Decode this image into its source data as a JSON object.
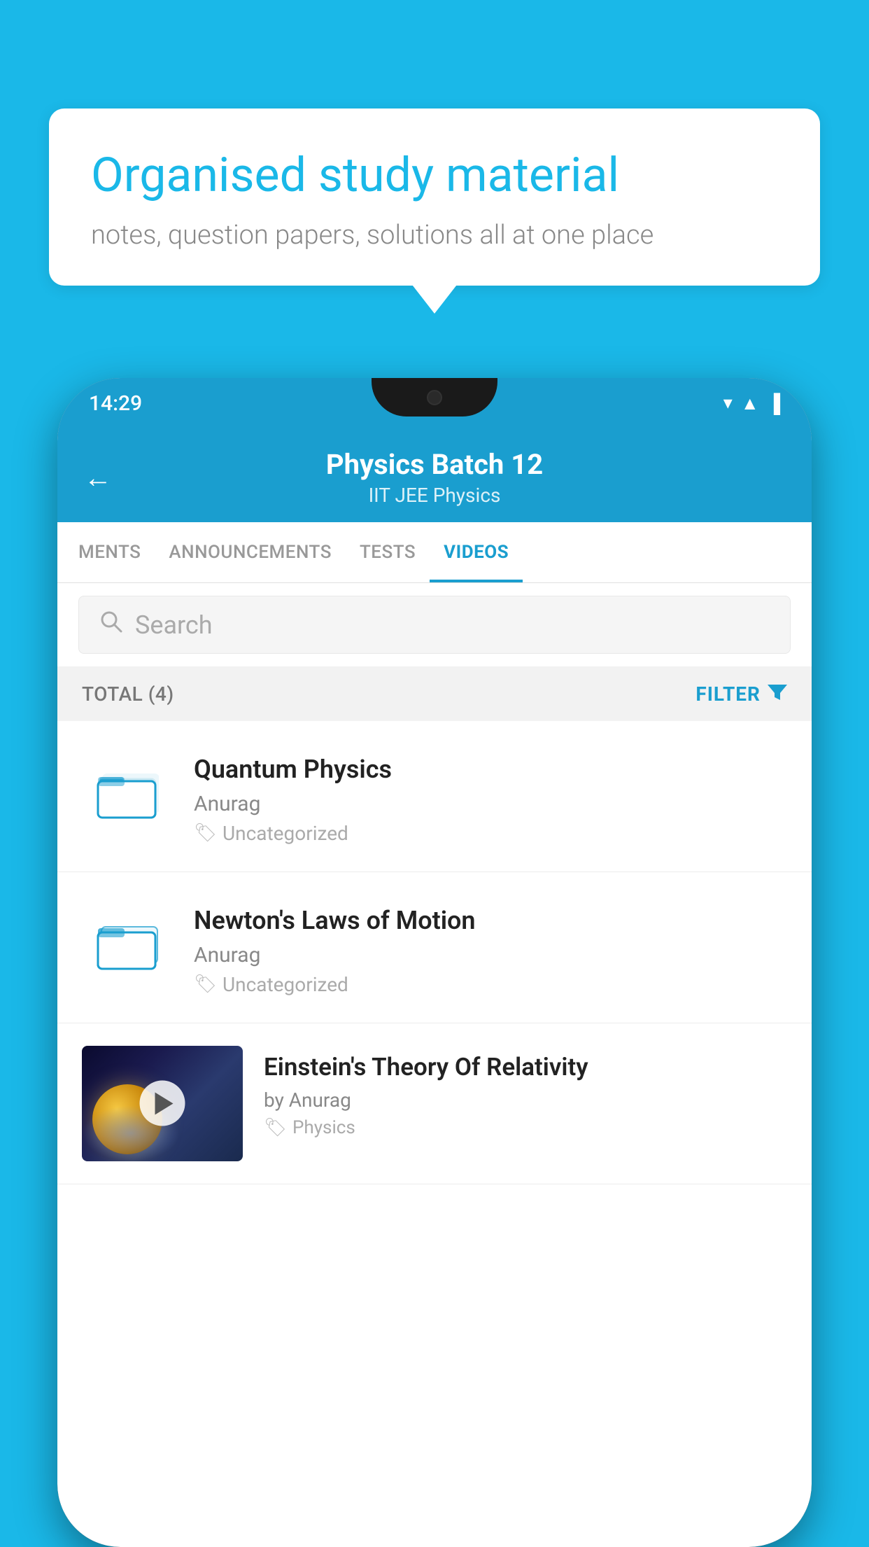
{
  "background": {
    "color": "#1ab8e8"
  },
  "speech_bubble": {
    "heading": "Organised study material",
    "subtext": "notes, question papers, solutions all at one place"
  },
  "phone": {
    "status_bar": {
      "time": "14:29",
      "icons": [
        "wifi",
        "signal",
        "battery"
      ]
    },
    "header": {
      "back_label": "←",
      "title": "Physics Batch 12",
      "subtitle": "IIT JEE   Physics"
    },
    "tabs": [
      {
        "label": "MENTS",
        "active": false
      },
      {
        "label": "ANNOUNCEMENTS",
        "active": false
      },
      {
        "label": "TESTS",
        "active": false
      },
      {
        "label": "VIDEOS",
        "active": true
      }
    ],
    "search": {
      "placeholder": "Search"
    },
    "filter_row": {
      "total_label": "TOTAL (4)",
      "filter_label": "FILTER"
    },
    "video_list": [
      {
        "id": "quantum",
        "title": "Quantum Physics",
        "author": "Anurag",
        "tag": "Uncategorized",
        "has_thumbnail": false
      },
      {
        "id": "newton",
        "title": "Newton's Laws of Motion",
        "author": "Anurag",
        "tag": "Uncategorized",
        "has_thumbnail": false
      },
      {
        "id": "einstein",
        "title": "Einstein's Theory Of Relativity",
        "author": "by Anurag",
        "tag": "Physics",
        "has_thumbnail": true
      }
    ]
  }
}
